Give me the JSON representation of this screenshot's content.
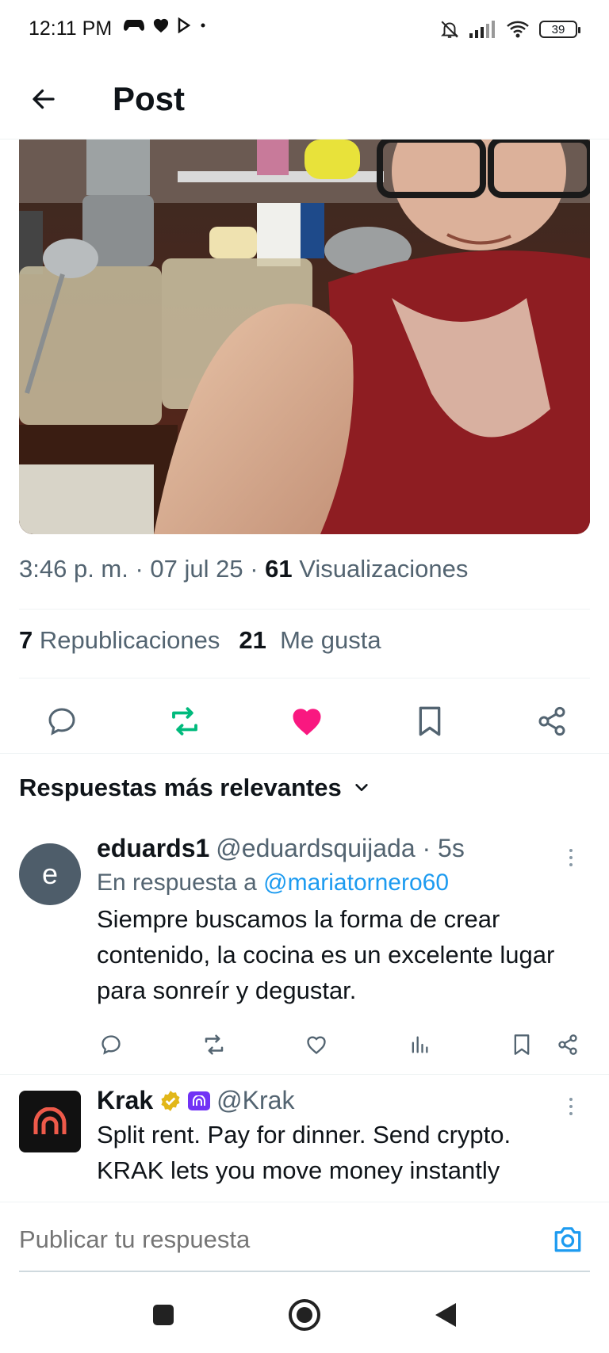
{
  "status_bar": {
    "time": "12:11 PM",
    "battery": "39"
  },
  "header": {
    "title": "Post"
  },
  "post": {
    "meta_time": "3:46 p. m. · 07 jul 25 · ",
    "views_count": "61",
    "views_label": "Visualizaciones",
    "reposts_count": "7",
    "reposts_label": "Republicaciones",
    "likes_count": "21",
    "likes_label": "Me gusta"
  },
  "replies_sort": {
    "label": "Respuestas más relevantes"
  },
  "replies": [
    {
      "avatar_letter": "e",
      "name": "eduards1",
      "handle": "@eduardsquijada · 5s",
      "in_reply_prefix": "En respuesta a ",
      "in_reply_mention": "@mariatornero60",
      "text": "Siempre buscamos la forma de crear contenido, la cocina es un excelente lugar para sonreír y degustar."
    },
    {
      "name": "Krak",
      "handle": "@Krak",
      "text": "Split rent. Pay for dinner. Send crypto. KRAK lets you move money instantly"
    }
  ],
  "composer": {
    "placeholder": "Publicar tu respuesta"
  },
  "colors": {
    "like": "#f91880",
    "repost": "#00ba7c",
    "link": "#1d9bf0",
    "muted": "#536471"
  }
}
